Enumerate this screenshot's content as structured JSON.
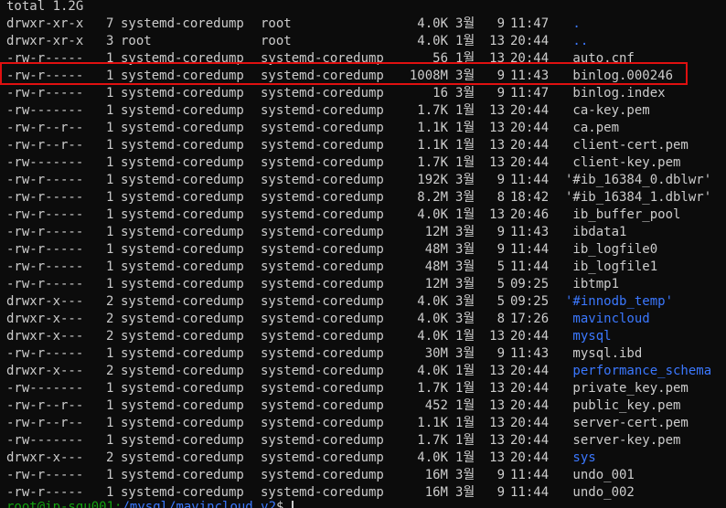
{
  "terminal": {
    "total": "total 1.2G",
    "rows": [
      {
        "perm": "drwxr-xr-x",
        "links": "7",
        "owner": "systemd-coredump",
        "group": "root",
        "size": "4.0K",
        "month": "3월",
        "day": "9",
        "time": "11:47",
        "name": " .",
        "is_dir": true
      },
      {
        "perm": "drwxr-xr-x",
        "links": "3",
        "owner": "root",
        "group": "root",
        "size": "4.0K",
        "month": "1월",
        "day": "13",
        "time": "20:44",
        "name": " ..",
        "is_dir": true
      },
      {
        "perm": "-rw-r-----",
        "links": "1",
        "owner": "systemd-coredump",
        "group": "systemd-coredump",
        "size": "56",
        "month": "1월",
        "day": "13",
        "time": "20:44",
        "name": " auto.cnf",
        "is_dir": false
      },
      {
        "perm": "-rw-r-----",
        "links": "1",
        "owner": "systemd-coredump",
        "group": "systemd-coredump",
        "size": "1008M",
        "month": "3월",
        "day": "9",
        "time": "11:43",
        "name": " binlog.000246",
        "is_dir": false,
        "highlighted": true
      },
      {
        "perm": "-rw-r-----",
        "links": "1",
        "owner": "systemd-coredump",
        "group": "systemd-coredump",
        "size": "16",
        "month": "3월",
        "day": "9",
        "time": "11:47",
        "name": " binlog.index",
        "is_dir": false
      },
      {
        "perm": "-rw-------",
        "links": "1",
        "owner": "systemd-coredump",
        "group": "systemd-coredump",
        "size": "1.7K",
        "month": "1월",
        "day": "13",
        "time": "20:44",
        "name": " ca-key.pem",
        "is_dir": false
      },
      {
        "perm": "-rw-r--r--",
        "links": "1",
        "owner": "systemd-coredump",
        "group": "systemd-coredump",
        "size": "1.1K",
        "month": "1월",
        "day": "13",
        "time": "20:44",
        "name": " ca.pem",
        "is_dir": false
      },
      {
        "perm": "-rw-r--r--",
        "links": "1",
        "owner": "systemd-coredump",
        "group": "systemd-coredump",
        "size": "1.1K",
        "month": "1월",
        "day": "13",
        "time": "20:44",
        "name": " client-cert.pem",
        "is_dir": false
      },
      {
        "perm": "-rw-------",
        "links": "1",
        "owner": "systemd-coredump",
        "group": "systemd-coredump",
        "size": "1.7K",
        "month": "1월",
        "day": "13",
        "time": "20:44",
        "name": " client-key.pem",
        "is_dir": false
      },
      {
        "perm": "-rw-r-----",
        "links": "1",
        "owner": "systemd-coredump",
        "group": "systemd-coredump",
        "size": "192K",
        "month": "3월",
        "day": "9",
        "time": "11:44",
        "name": "'#ib_16384_0.dblwr'",
        "is_dir": false
      },
      {
        "perm": "-rw-r-----",
        "links": "1",
        "owner": "systemd-coredump",
        "group": "systemd-coredump",
        "size": "8.2M",
        "month": "3월",
        "day": "8",
        "time": "18:42",
        "name": "'#ib_16384_1.dblwr'",
        "is_dir": false
      },
      {
        "perm": "-rw-r-----",
        "links": "1",
        "owner": "systemd-coredump",
        "group": "systemd-coredump",
        "size": "4.0K",
        "month": "1월",
        "day": "13",
        "time": "20:46",
        "name": " ib_buffer_pool",
        "is_dir": false
      },
      {
        "perm": "-rw-r-----",
        "links": "1",
        "owner": "systemd-coredump",
        "group": "systemd-coredump",
        "size": "12M",
        "month": "3월",
        "day": "9",
        "time": "11:43",
        "name": " ibdata1",
        "is_dir": false
      },
      {
        "perm": "-rw-r-----",
        "links": "1",
        "owner": "systemd-coredump",
        "group": "systemd-coredump",
        "size": "48M",
        "month": "3월",
        "day": "9",
        "time": "11:44",
        "name": " ib_logfile0",
        "is_dir": false
      },
      {
        "perm": "-rw-r-----",
        "links": "1",
        "owner": "systemd-coredump",
        "group": "systemd-coredump",
        "size": "48M",
        "month": "3월",
        "day": "5",
        "time": "11:44",
        "name": " ib_logfile1",
        "is_dir": false
      },
      {
        "perm": "-rw-r-----",
        "links": "1",
        "owner": "systemd-coredump",
        "group": "systemd-coredump",
        "size": "12M",
        "month": "3월",
        "day": "5",
        "time": "09:25",
        "name": " ibtmp1",
        "is_dir": false
      },
      {
        "perm": "drwxr-x---",
        "links": "2",
        "owner": "systemd-coredump",
        "group": "systemd-coredump",
        "size": "4.0K",
        "month": "3월",
        "day": "5",
        "time": "09:25",
        "name": "'#innodb_temp'",
        "is_dir": true
      },
      {
        "perm": "drwxr-x---",
        "links": "2",
        "owner": "systemd-coredump",
        "group": "systemd-coredump",
        "size": "4.0K",
        "month": "3월",
        "day": "8",
        "time": "17:26",
        "name": " mavincloud",
        "is_dir": true
      },
      {
        "perm": "drwxr-x---",
        "links": "2",
        "owner": "systemd-coredump",
        "group": "systemd-coredump",
        "size": "4.0K",
        "month": "1월",
        "day": "13",
        "time": "20:44",
        "name": " mysql",
        "is_dir": true
      },
      {
        "perm": "-rw-r-----",
        "links": "1",
        "owner": "systemd-coredump",
        "group": "systemd-coredump",
        "size": "30M",
        "month": "3월",
        "day": "9",
        "time": "11:43",
        "name": " mysql.ibd",
        "is_dir": false
      },
      {
        "perm": "drwxr-x---",
        "links": "2",
        "owner": "systemd-coredump",
        "group": "systemd-coredump",
        "size": "4.0K",
        "month": "1월",
        "day": "13",
        "time": "20:44",
        "name": " performance_schema",
        "is_dir": true
      },
      {
        "perm": "-rw-------",
        "links": "1",
        "owner": "systemd-coredump",
        "group": "systemd-coredump",
        "size": "1.7K",
        "month": "1월",
        "day": "13",
        "time": "20:44",
        "name": " private_key.pem",
        "is_dir": false
      },
      {
        "perm": "-rw-r--r--",
        "links": "1",
        "owner": "systemd-coredump",
        "group": "systemd-coredump",
        "size": "452",
        "month": "1월",
        "day": "13",
        "time": "20:44",
        "name": " public_key.pem",
        "is_dir": false
      },
      {
        "perm": "-rw-r--r--",
        "links": "1",
        "owner": "systemd-coredump",
        "group": "systemd-coredump",
        "size": "1.1K",
        "month": "1월",
        "day": "13",
        "time": "20:44",
        "name": " server-cert.pem",
        "is_dir": false
      },
      {
        "perm": "-rw-------",
        "links": "1",
        "owner": "systemd-coredump",
        "group": "systemd-coredump",
        "size": "1.7K",
        "month": "1월",
        "day": "13",
        "time": "20:44",
        "name": " server-key.pem",
        "is_dir": false
      },
      {
        "perm": "drwxr-x---",
        "links": "2",
        "owner": "systemd-coredump",
        "group": "systemd-coredump",
        "size": "4.0K",
        "month": "1월",
        "day": "13",
        "time": "20:44",
        "name": " sys",
        "is_dir": true
      },
      {
        "perm": "-rw-r-----",
        "links": "1",
        "owner": "systemd-coredump",
        "group": "systemd-coredump",
        "size": "16M",
        "month": "3월",
        "day": "9",
        "time": "11:44",
        "name": " undo_001",
        "is_dir": false
      },
      {
        "perm": "-rw-r-----",
        "links": "1",
        "owner": "systemd-coredump",
        "group": "systemd-coredump",
        "size": "16M",
        "month": "3월",
        "day": "9",
        "time": "11:44",
        "name": " undo_002",
        "is_dir": false
      }
    ],
    "prompt_user": "root@ip-sgu001:",
    "prompt_path": "/mysql/mavincloud_v2",
    "prompt_symbol": "$ "
  },
  "colors": {
    "background": "#0c0c0c",
    "text": "#cccccc",
    "directory": "#3b78ff",
    "highlight_border": "#e01010",
    "prompt_user": "#13a10e"
  }
}
